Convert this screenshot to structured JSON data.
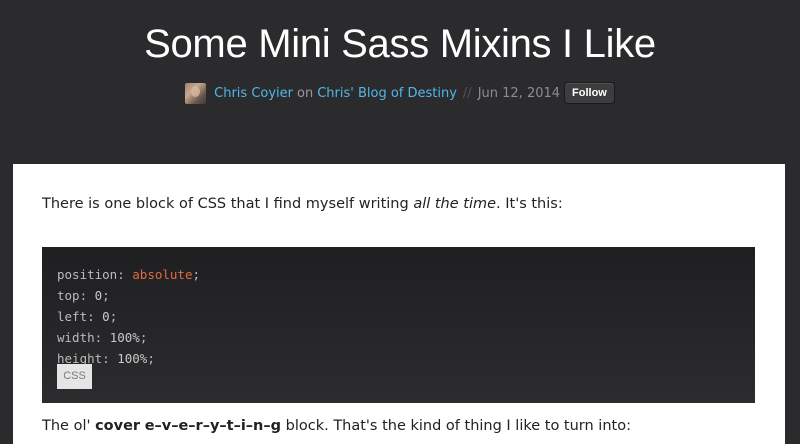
{
  "article": {
    "title": "Some Mini Sass Mixins I Like",
    "author": "Chris Coyier",
    "on_text": "on",
    "blog": "Chris' Blog of Destiny",
    "separator": "//",
    "date": "Jun 12, 2014",
    "follow_label": "Follow"
  },
  "content": {
    "p1_before": "There is one block of CSS that I find myself writing ",
    "p1_em": "all the time",
    "p1_after": ". It's this:",
    "code_lines": [
      {
        "prop": "position",
        "value": "absolute",
        "value_type": "kw"
      },
      {
        "prop": "top",
        "value": "0",
        "value_type": "num"
      },
      {
        "prop": "left",
        "value": "0",
        "value_type": "num"
      },
      {
        "prop": "width",
        "value": "100%",
        "value_type": "num"
      },
      {
        "prop": "height",
        "value": "100%",
        "value_type": "num"
      }
    ],
    "code_lang": "CSS",
    "p2_before": "The ol' ",
    "p2_strong1": "cover",
    "p2_strong2": "e–v–e–r–y–t–i–n–g",
    "p2_after": " block. That's the kind of thing I like to turn into:"
  },
  "colors": {
    "background": "#2b2b2d",
    "link": "#4fb8e8",
    "keyword": "#e06a41",
    "code_bg": "#252527"
  },
  "icons": {
    "avatar": "author-avatar"
  }
}
